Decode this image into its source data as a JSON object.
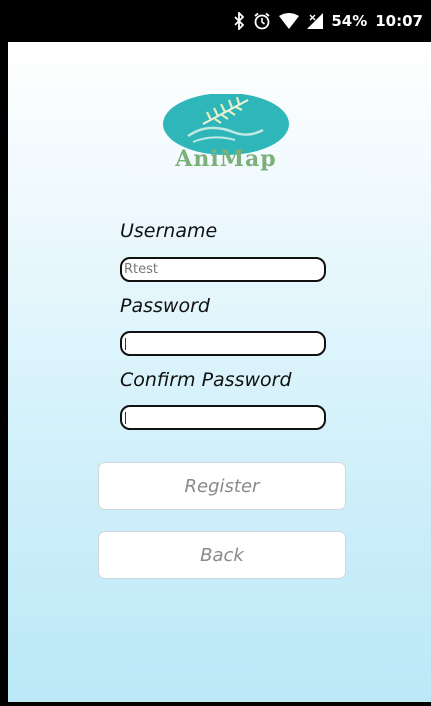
{
  "status_bar": {
    "battery_percent": "54%",
    "time": "10:07",
    "icons": [
      "bluetooth-icon",
      "alarm-icon",
      "wifi-icon",
      "signal-icon"
    ]
  },
  "logo": {
    "text": "AniMap"
  },
  "form": {
    "username": {
      "label": "Username",
      "value": "Rtest"
    },
    "password": {
      "label": "Password",
      "value": ""
    },
    "confirm_password": {
      "label": "Confirm Password",
      "value": ""
    }
  },
  "buttons": {
    "register": "Register",
    "back": "Back"
  },
  "colors": {
    "background_top": "#ffffff",
    "background_bottom": "#bbe8f7",
    "logo_teal": "#2fb6b9",
    "logo_green": "#7bb07a"
  }
}
